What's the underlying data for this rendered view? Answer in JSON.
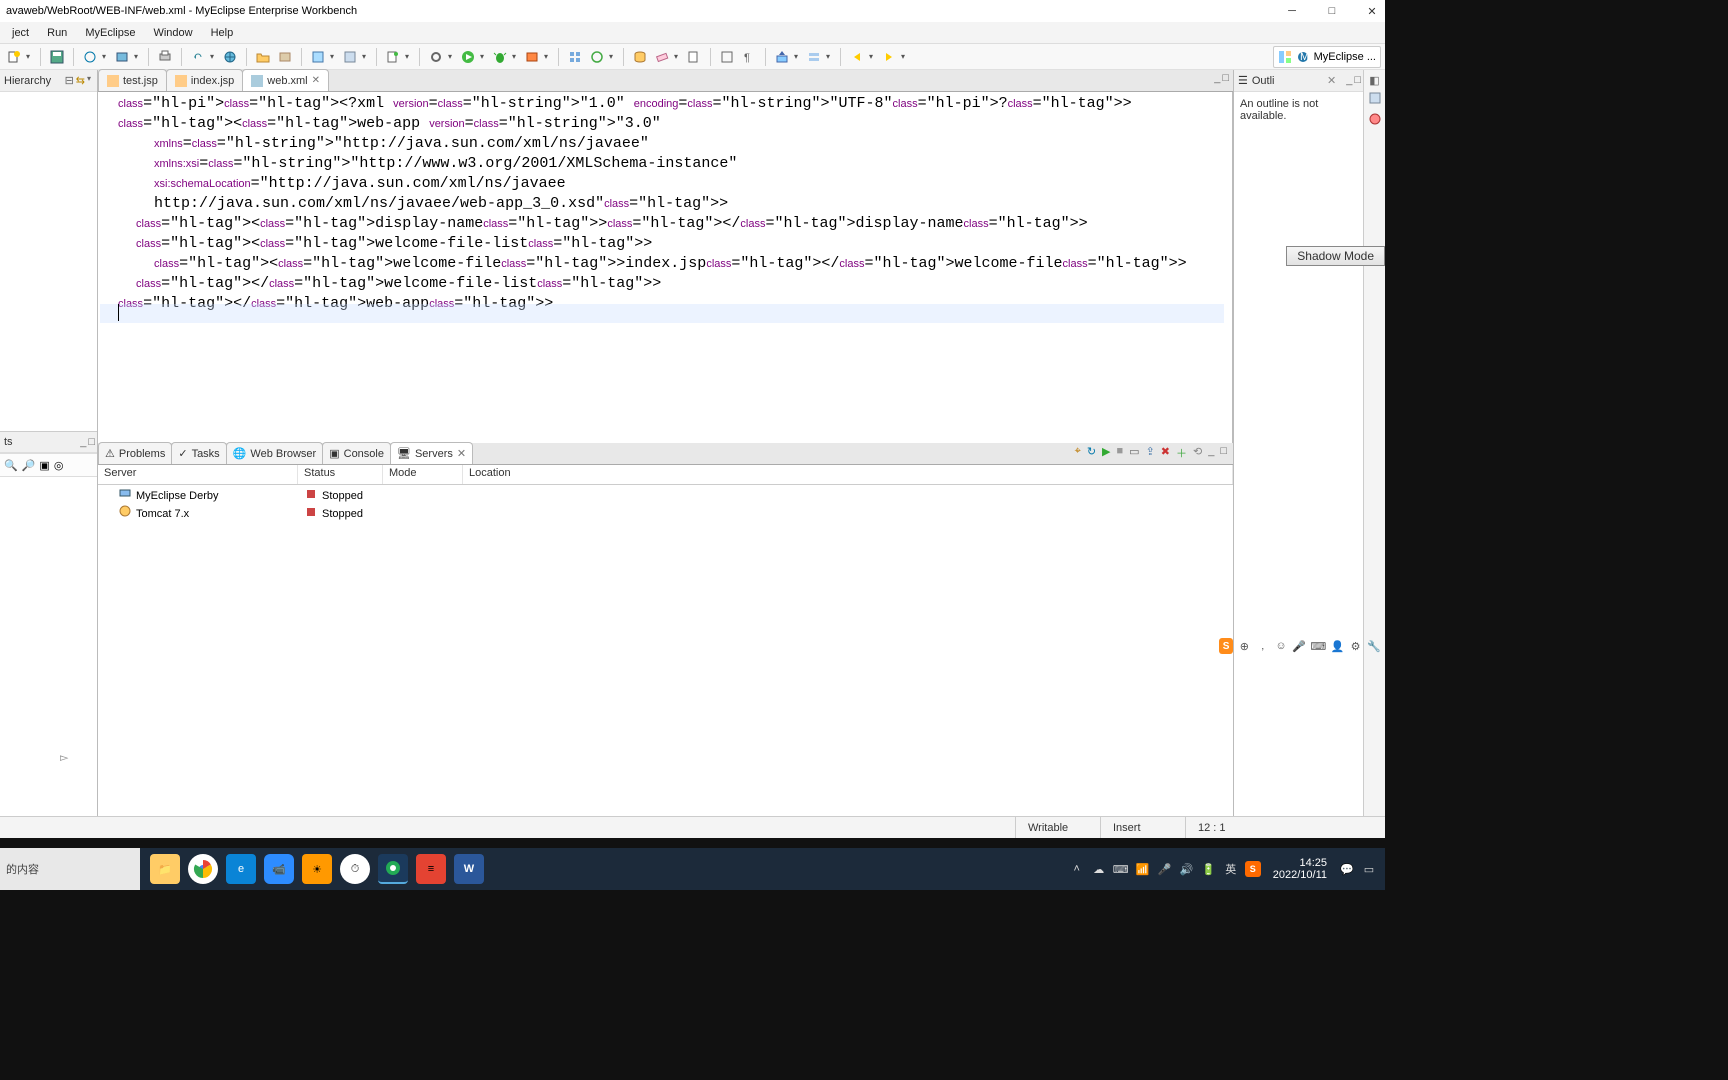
{
  "window": {
    "title": "avaweb/WebRoot/WEB-INF/web.xml - MyEclipse Enterprise Workbench"
  },
  "menu": {
    "items": [
      "ject",
      "Run",
      "MyEclipse",
      "Window",
      "Help"
    ]
  },
  "perspective_label": "MyEclipse ...",
  "left_view_title": "Hierarchy",
  "left_bottom_title": "ts",
  "outline": {
    "title": "Outli",
    "message": "An outline is not available."
  },
  "shadow_mode": "Shadow Mode",
  "editor": {
    "tabs": [
      {
        "label": "test.jsp",
        "active": false
      },
      {
        "label": "index.jsp",
        "active": false
      },
      {
        "label": "web.xml",
        "active": true
      }
    ],
    "code_lines": [
      "<?xml version=\"1.0\" encoding=\"UTF-8\"?>",
      "<web-app version=\"3.0\"",
      "    xmlns=\"http://java.sun.com/xml/ns/javaee\"",
      "    xmlns:xsi=\"http://www.w3.org/2001/XMLSchema-instance\"",
      "    xsi:schemaLocation=\"http://java.sun.com/xml/ns/javaee",
      "    http://java.sun.com/xml/ns/javaee/web-app_3_0.xsd\">",
      "  <display-name></display-name>",
      "  <welcome-file-list>",
      "    <welcome-file>index.jsp</welcome-file>",
      "  </welcome-file-list>",
      "</web-app>"
    ]
  },
  "bottom_tabs": {
    "items": [
      {
        "label": "Problems"
      },
      {
        "label": "Tasks"
      },
      {
        "label": "Web Browser"
      },
      {
        "label": "Console"
      },
      {
        "label": "Servers",
        "active": true
      }
    ]
  },
  "servers": {
    "columns": [
      "Server",
      "Status",
      "Mode",
      "Location"
    ],
    "rows": [
      {
        "name": "MyEclipse Derby",
        "status": "Stopped",
        "mode": "",
        "location": ""
      },
      {
        "name": "Tomcat  7.x",
        "status": "Stopped",
        "mode": "",
        "location": ""
      }
    ]
  },
  "status": {
    "writable": "Writable",
    "insert": "Insert",
    "position": "12 : 1"
  },
  "taskbar": {
    "time": "14:25",
    "date": "2022/10/11"
  },
  "chinese_label": "的内容"
}
